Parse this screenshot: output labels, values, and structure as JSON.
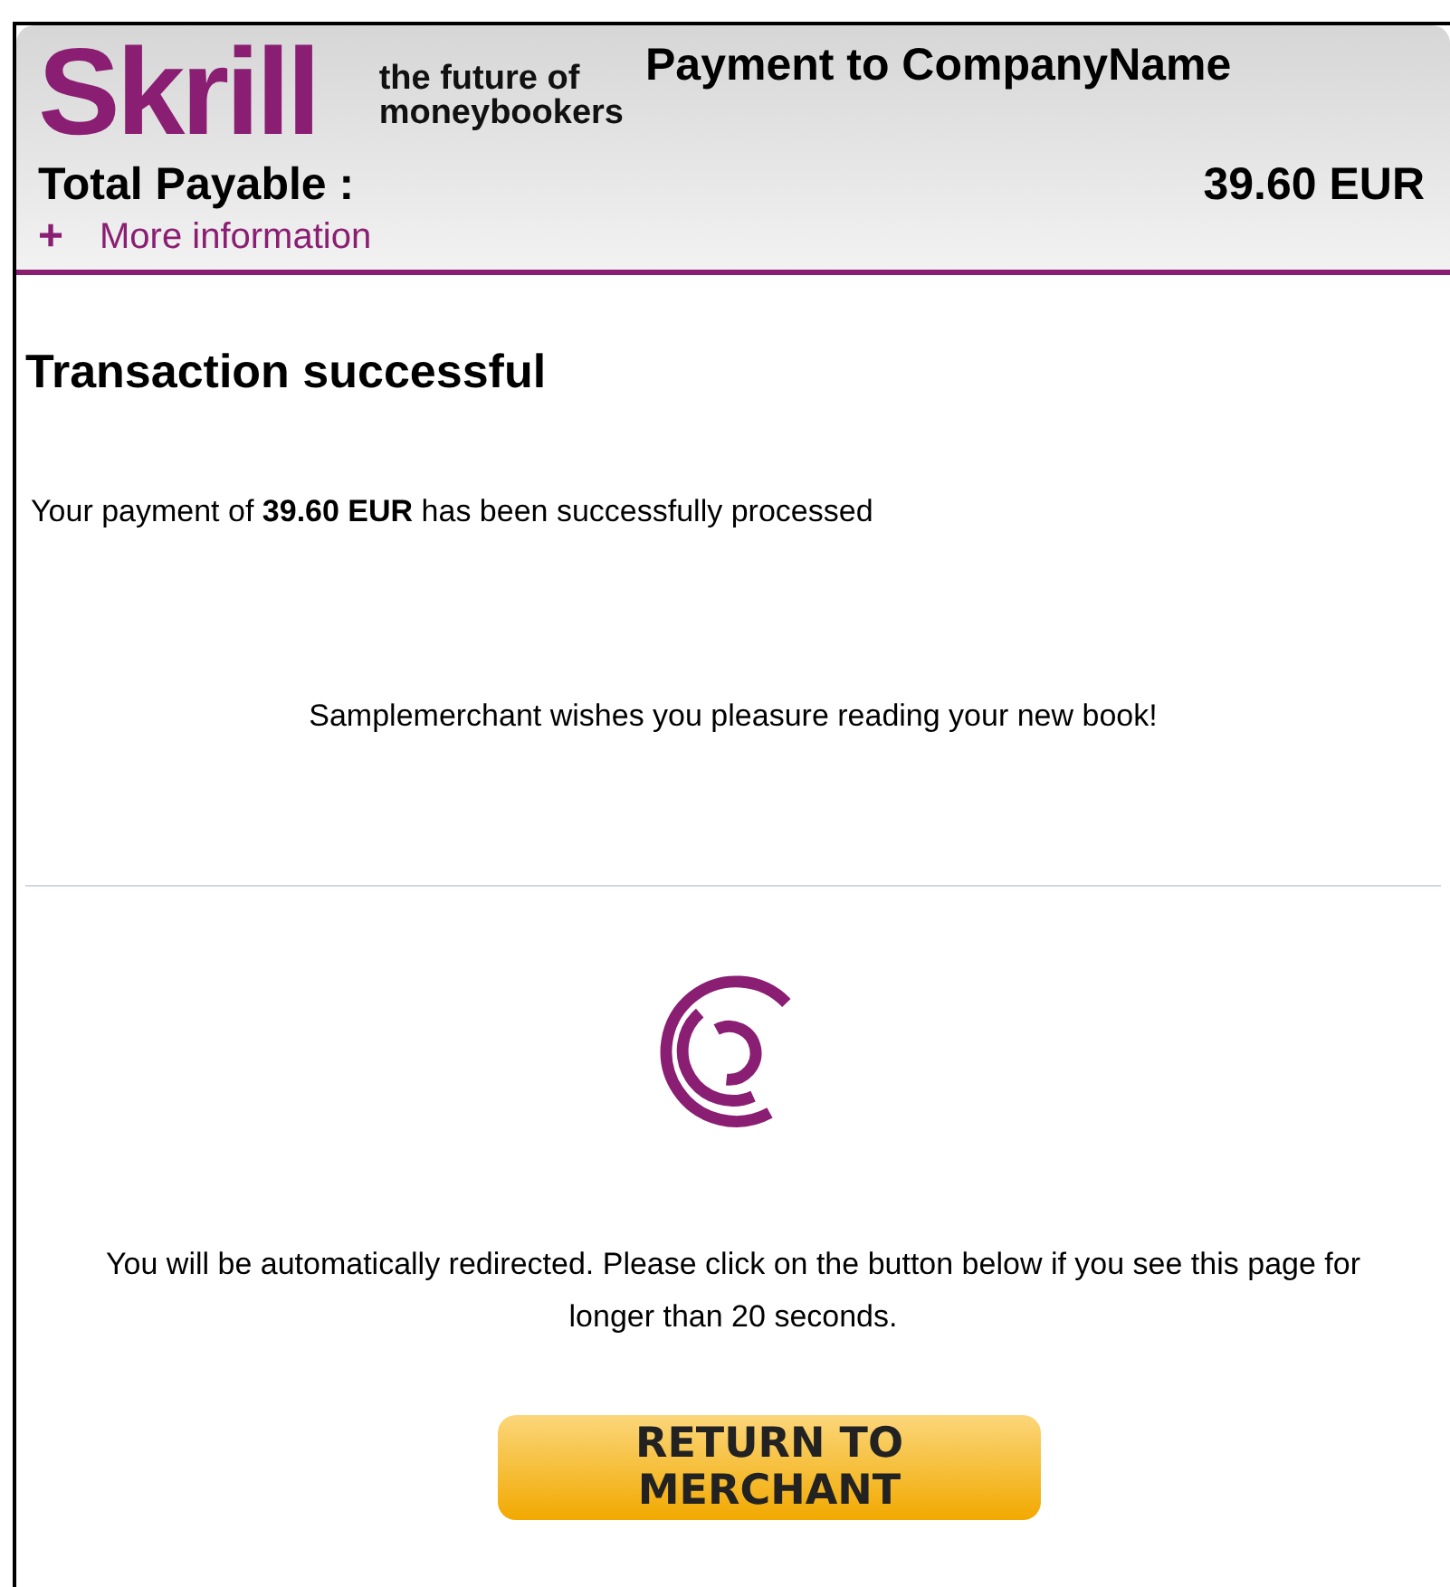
{
  "header": {
    "logo": "Skrill",
    "tagline": [
      "the future of",
      "moneybookers"
    ],
    "payee": "Payment to CompanyName",
    "total_label": "Total Payable :",
    "total_amount": "39.60 EUR",
    "more_icon": "+",
    "more_link": "More information"
  },
  "body": {
    "title": "Transaction successful",
    "message": "Your payment of **39.60 EUR** has been successfully processed",
    "merchant_note": "Samplemerchant wishes you pleasure reading your new book!",
    "redirect_note": "You will be automatically redirected. Please click on the button below if you see this page for longer than 20 seconds.",
    "button": "RETURN TO MERCHANT"
  }
}
